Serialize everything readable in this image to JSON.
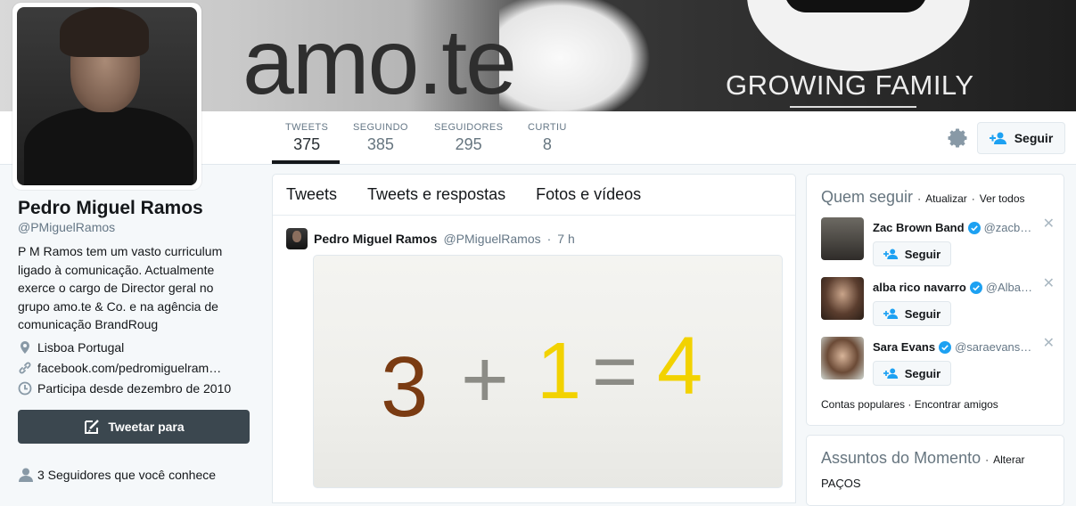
{
  "banner": {
    "text_brand": "amo.te",
    "tagline": "GROWING FAMILY"
  },
  "profile": {
    "name": "Pedro Miguel Ramos",
    "handle": "@PMiguelRamos",
    "bio": "P M Ramos tem um vasto curriculum ligado à comunicação. Actualmente exerce o cargo de Director geral no grupo amo.te & Co. e na agência de comunicação BrandRoug",
    "location": "Lisboa Portugal",
    "url": "facebook.com/pedromiguelram…",
    "joined": "Participa desde dezembro de 2010",
    "tweet_to_label": "Tweetar para",
    "followers_you_know": "3 Seguidores que você conhece"
  },
  "stats": [
    {
      "label": "TWEETS",
      "value": "375"
    },
    {
      "label": "SEGUINDO",
      "value": "385"
    },
    {
      "label": "SEGUIDORES",
      "value": "295"
    },
    {
      "label": "CURTIU",
      "value": "8"
    }
  ],
  "actions": {
    "follow_label": "Seguir",
    "settings_icon": "gear-icon"
  },
  "timeline": {
    "tabs": [
      "Tweets",
      "Tweets e respostas",
      "Fotos e vídeos"
    ],
    "tweet": {
      "author": "Pedro Miguel Ramos",
      "handle": "@PMiguelRamos",
      "separator": "·",
      "time": "7 h",
      "image_text": {
        "a": "3",
        "op1": "+",
        "b": "1",
        "op2": "=",
        "c": "4"
      }
    }
  },
  "who_to_follow": {
    "title": "Quem seguir",
    "sep": "·",
    "refresh": "Atualizar",
    "view_all": "Ver todos",
    "suggestions": [
      {
        "name": "Zac Brown Band",
        "handle": "@zacb…",
        "follow": "Seguir"
      },
      {
        "name": "alba rico navarro",
        "handle": "@Alba…",
        "follow": "Seguir"
      },
      {
        "name": "Sara Evans",
        "handle": "@saraevans…",
        "follow": "Seguir"
      }
    ],
    "footer_popular": "Contas populares",
    "footer_sep": "·",
    "footer_find": "Encontrar amigos"
  },
  "trends": {
    "title": "Assuntos do Momento",
    "sep": "·",
    "change": "Alterar",
    "first_item": "PAÇOS"
  },
  "colors": {
    "accent": "#1da1f2",
    "dark_button": "#3b474f",
    "verified": "#1da1f2"
  }
}
